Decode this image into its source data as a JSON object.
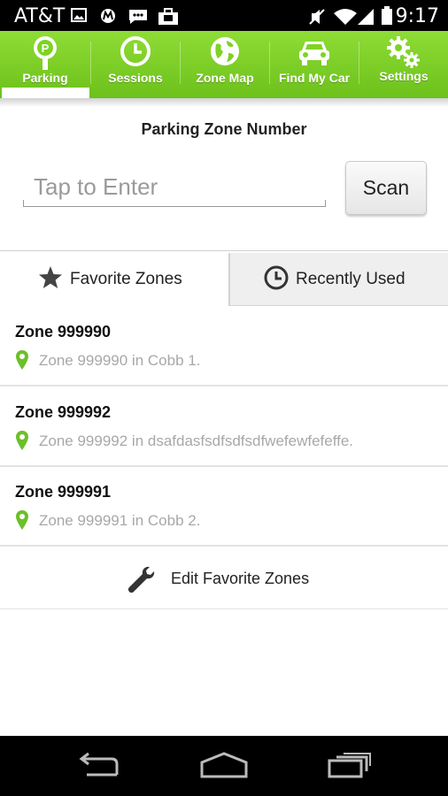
{
  "status_bar": {
    "carrier": "AT&T",
    "time": "9:17",
    "icons": [
      "image-icon",
      "motorola-icon",
      "messaging-icon",
      "briefcase-icon",
      "mute-icon",
      "wifi-icon",
      "signal-icon",
      "battery-icon"
    ]
  },
  "nav": {
    "items": [
      {
        "label": "Parking",
        "icon": "parking-meter-icon",
        "active": true
      },
      {
        "label": "Sessions",
        "icon": "clock-icon"
      },
      {
        "label": "Zone Map",
        "icon": "globe-icon"
      },
      {
        "label": "Find My Car",
        "icon": "car-icon"
      },
      {
        "label": "Settings",
        "icon": "gears-icon"
      }
    ],
    "color": "#7ed321"
  },
  "zone_entry": {
    "title": "Parking Zone Number",
    "placeholder": "Tap to Enter",
    "scan_label": "Scan"
  },
  "tabs": {
    "favorites": {
      "label": "Favorite Zones",
      "icon": "star-icon",
      "selected": true
    },
    "recent": {
      "label": "Recently Used",
      "icon": "clock-icon"
    }
  },
  "zones": [
    {
      "name": "Zone 999990",
      "desc": "Zone 999990 in Cobb 1."
    },
    {
      "name": "Zone 999992",
      "desc": "Zone 999992 in dsafdasfsdfsdfsdfwefewfefeffe."
    },
    {
      "name": "Zone 999991",
      "desc": "Zone 999991 in Cobb 2."
    }
  ],
  "edit_label": "Edit Favorite Zones",
  "system_nav": [
    "back-icon",
    "home-icon",
    "recents-icon"
  ]
}
